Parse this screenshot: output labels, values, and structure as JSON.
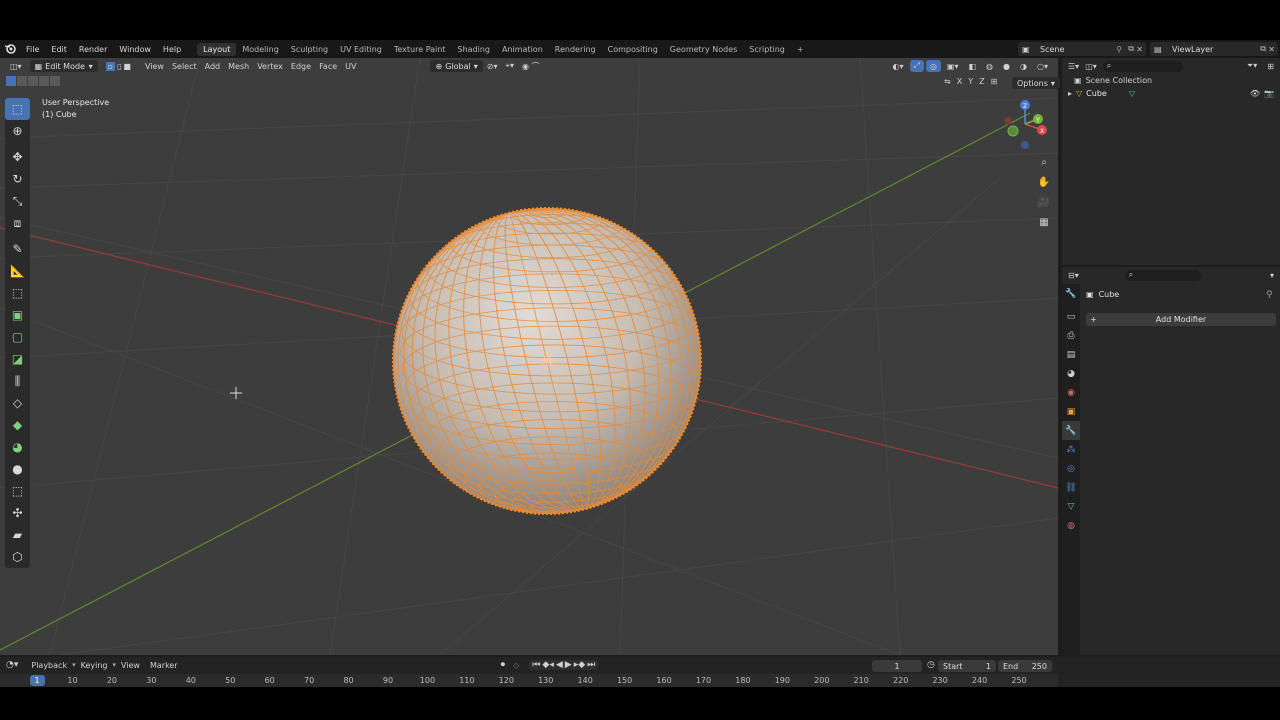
{
  "menu": {
    "items": [
      "File",
      "Edit",
      "Render",
      "Window",
      "Help"
    ]
  },
  "workspaces": {
    "tabs": [
      "Layout",
      "Modeling",
      "Sculpting",
      "UV Editing",
      "Texture Paint",
      "Shading",
      "Animation",
      "Rendering",
      "Compositing",
      "Geometry Nodes",
      "Scripting"
    ],
    "active": "Layout",
    "add_label": "+"
  },
  "scene": {
    "name": "Scene"
  },
  "view_layer": {
    "name": "ViewLayer"
  },
  "viewport_header": {
    "mode": "Edit Mode",
    "menus": [
      "View",
      "Select",
      "Add",
      "Mesh",
      "Vertex",
      "Edge",
      "Face",
      "UV"
    ],
    "orientation": "Global",
    "options_label": "Options",
    "axes": [
      "X",
      "Y",
      "Z"
    ]
  },
  "viewport_overlay": {
    "view_name": "User Perspective",
    "object_name": "(1) Cube"
  },
  "gizmo": {
    "x": "X",
    "y": "Y",
    "z": "Z"
  },
  "outliner": {
    "collection": "Scene Collection",
    "object": "Cube"
  },
  "properties": {
    "object_name": "Cube",
    "add_modifier_label": "Add Modifier"
  },
  "timeline": {
    "menus": [
      "Playback",
      "Keying",
      "View",
      "Marker"
    ],
    "current_frame": "1",
    "start_label": "Start",
    "start_value": "1",
    "end_label": "End",
    "end_value": "250",
    "ticks": [
      "1",
      "10",
      "20",
      "30",
      "40",
      "50",
      "60",
      "70",
      "80",
      "90",
      "100",
      "110",
      "120",
      "130",
      "140",
      "150",
      "160",
      "170",
      "180",
      "190",
      "200",
      "210",
      "220",
      "230",
      "240",
      "250"
    ]
  },
  "colors": {
    "accent": "#4772b3",
    "selection_orange": "#ff8a1f",
    "x_axis": "#a33a3a",
    "y_axis": "#5f8a2a"
  }
}
